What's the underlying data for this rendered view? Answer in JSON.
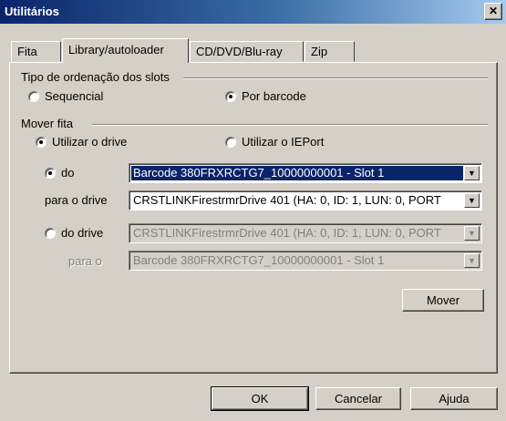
{
  "window": {
    "title": "Utilitários",
    "close_glyph": "✕"
  },
  "tabs": [
    {
      "label": "Fita",
      "active": false
    },
    {
      "label": "Library/autoloader",
      "active": true
    },
    {
      "label": "CD/DVD/Blu-ray",
      "active": false
    },
    {
      "label": "Zip",
      "active": false
    }
  ],
  "sort_group": {
    "title": "Tipo de ordenação dos slots",
    "options": [
      {
        "label": "Sequencial",
        "checked": false
      },
      {
        "label": "Por barcode",
        "checked": true
      }
    ]
  },
  "move_group": {
    "title": "Mover fita",
    "options": [
      {
        "label": "Utilizar o drive",
        "checked": true
      },
      {
        "label": "Utilizar o IEPort",
        "checked": false
      }
    ],
    "from_slot": {
      "radio_label": "do",
      "checked": true,
      "value": "Barcode 380FRXRCTG7_10000000001 - Slot 1"
    },
    "to_drive": {
      "label": "para o drive",
      "value": "CRSTLINKFirestrmrDrive  401 (HA: 0, ID: 1, LUN: 0, PORT"
    },
    "from_drive": {
      "radio_label": "do drive",
      "checked": false,
      "value": "CRSTLINKFirestrmrDrive  401 (HA: 0, ID: 1, LUN: 0, PORT"
    },
    "to_slot": {
      "label": "para o",
      "value": "Barcode 380FRXRCTG7_10000000001 - Slot 1"
    },
    "move_button": "Mover"
  },
  "footer": {
    "ok": "OK",
    "cancel": "Cancelar",
    "help": "Ajuda"
  },
  "colors": {
    "title_start": "#0a246a",
    "title_end": "#a6caf0",
    "face": "#d4d0c8",
    "selection": "#0a246a"
  }
}
